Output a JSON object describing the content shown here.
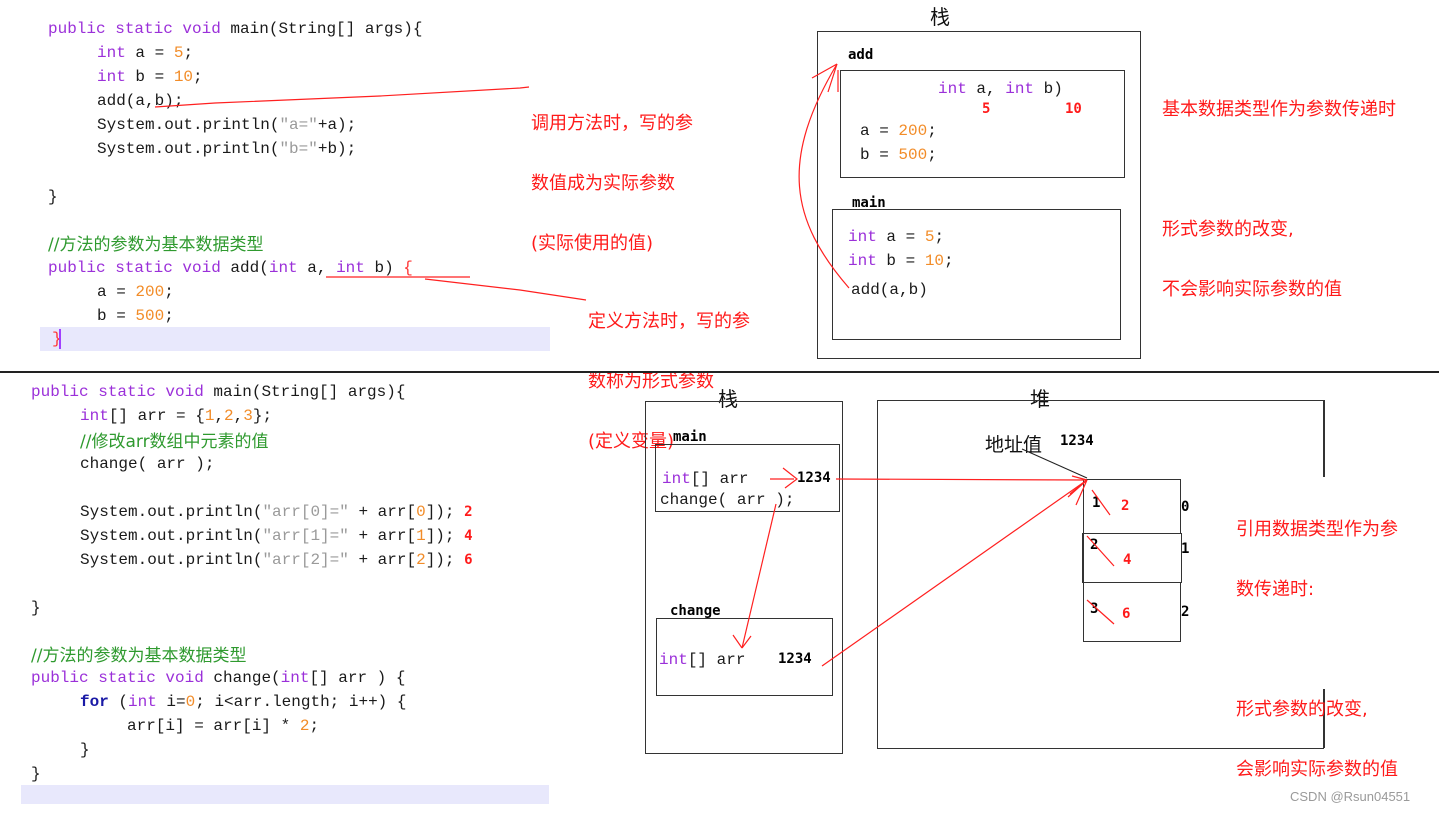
{
  "top": {
    "code_main": {
      "signature": [
        "public static void",
        " main(String[] args){"
      ],
      "lines": [
        {
          "kw": "int",
          "rest": " a = ",
          "num": "5",
          ";": ";"
        },
        {
          "kw": "int",
          "rest": " b = ",
          "num": "10",
          ";": ";"
        }
      ],
      "call": "add(a,b);",
      "print_a": [
        "System.out.println(",
        "\"a=\"",
        "+a);"
      ],
      "print_b": [
        "System.out.println(",
        "\"b=\"",
        "+b);"
      ],
      "close": "}"
    },
    "comment": "//方法的参数为基本数据类型",
    "code_add": {
      "signature_kw": "public static void",
      "signature_name": " add(",
      "params_kw1": "int",
      "params_a": " a, ",
      "params_kw2": "int",
      "params_b": " b)",
      "brace": " {",
      "line_a": [
        "a = ",
        "200",
        ";"
      ],
      "line_b": [
        "b = ",
        "500",
        ";"
      ],
      "close": "}"
    },
    "note_actual": [
      "调用方法时，写的参",
      "数值成为实际参数",
      "(实际使用的值)"
    ],
    "note_formal": [
      "定义方法时，写的参",
      "数称为形式参数",
      "(定义变量)"
    ],
    "stack_title": "栈",
    "frame_add": {
      "label": "add",
      "params": [
        "int",
        " a, ",
        "int",
        " b)"
      ],
      "values": [
        "5",
        "10"
      ],
      "line_a": [
        "a = ",
        "200",
        ";"
      ],
      "line_b": [
        "b = ",
        "500",
        ";"
      ]
    },
    "frame_main": {
      "label": "main",
      "line_a": [
        "int",
        " a = ",
        "5",
        ";"
      ],
      "line_b": [
        "int",
        " b = ",
        "10",
        ";"
      ],
      "call": "add(a,b)"
    },
    "explanation": [
      "基本数据类型作为参数传递时",
      "",
      "形式参数的改变,",
      "不会影响实际参数的值"
    ]
  },
  "bottom": {
    "code_main": {
      "signature": [
        "public static void",
        " main(String[] args){"
      ],
      "arr_decl": [
        "int",
        "[] arr = {",
        "1",
        ",",
        "2",
        ",",
        "3",
        "};"
      ],
      "comment": "//修改arr数组中元素的值",
      "call": "change( arr );",
      "prints": [
        {
          "pre": "System.out.println(",
          "str": "\"arr[0]=\"",
          "mid": " + arr[",
          "idx": "0",
          "post": "]);",
          "result": "2"
        },
        {
          "pre": "System.out.println(",
          "str": "\"arr[1]=\"",
          "mid": " + arr[",
          "idx": "1",
          "post": "]);",
          "result": "4"
        },
        {
          "pre": "System.out.println(",
          "str": "\"arr[2]=\"",
          "mid": " + arr[",
          "idx": "2",
          "post": "]);",
          "result": "6"
        }
      ],
      "close": "}"
    },
    "comment": "//方法的参数为基本数据类型",
    "code_change": {
      "signature_kw": "public static void",
      "signature_name": " change(",
      "param_kw": "int",
      "param_rest": "[] arr ) {",
      "for": [
        "for",
        " (",
        "int",
        " i=",
        "0",
        "; i<arr.length; i++) {"
      ],
      "body": [
        "arr[i] = arr[i] * ",
        "2",
        ";"
      ],
      "inner_close": "}",
      "close": "}"
    },
    "stack_title": "栈",
    "heap_title": "堆",
    "frame_main": {
      "label": "main",
      "decl": [
        "int",
        "[] arr",
        "1234"
      ],
      "call": "change( arr );"
    },
    "frame_change": {
      "label": "change",
      "decl": [
        "int",
        "[] arr ",
        "1234"
      ]
    },
    "address_label": "地址值",
    "address_value": "1234",
    "array_cells": [
      {
        "old": "1",
        "new": "2",
        "index": "0"
      },
      {
        "old": "2",
        "new": "4",
        "index": "1"
      },
      {
        "old": "3",
        "new": "6",
        "index": "2"
      }
    ],
    "explanation": [
      "引用数据类型作为参",
      "数传递时:",
      "",
      "形式参数的改变,",
      "会影响实际参数的值"
    ]
  },
  "watermark": "CSDN @Rsun04551",
  "colors": {
    "annotation": "#ff1a1a",
    "keyword": "#9b30d9",
    "number": "#f28c28",
    "comment": "#2f9a2f",
    "highlight": "#e8e8fc"
  }
}
